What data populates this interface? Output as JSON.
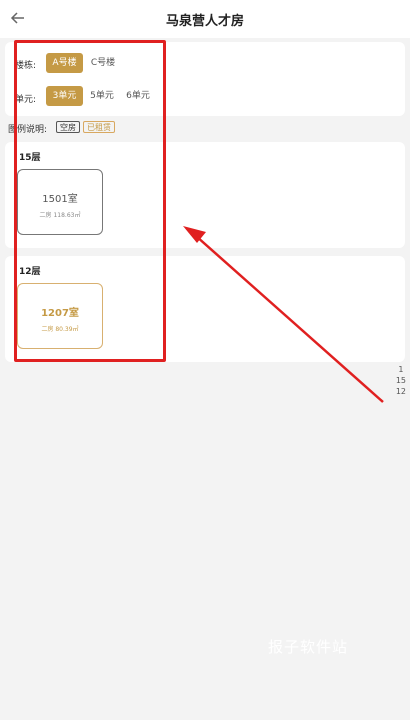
{
  "header": {
    "title": "马泉营人才房",
    "back_icon": "arrow-left-icon"
  },
  "filters": {
    "building_label": "楼栋:",
    "buildings": [
      {
        "label": "A号楼",
        "active": true
      },
      {
        "label": "C号楼",
        "active": false
      }
    ],
    "unit_label": "单元:",
    "units": [
      {
        "label": "3单元",
        "active": true
      },
      {
        "label": "5单元",
        "active": false
      },
      {
        "label": "6单元",
        "active": false
      }
    ]
  },
  "legend": {
    "label": "图例说明:",
    "empty": "空房",
    "rented": "已租赁"
  },
  "floors": [
    {
      "title": "15层",
      "room": {
        "name": "1501室",
        "info": "二房 118.63㎡",
        "status": "vacant"
      }
    },
    {
      "title": "12层",
      "room": {
        "name": "1207室",
        "info": "二房 80.39㎡",
        "status": "rented"
      }
    }
  ],
  "floor_index": [
    "1",
    "15",
    "12"
  ],
  "watermark": "报子软件站",
  "colors": {
    "accent": "#c59a45",
    "annotation": "#e02020"
  }
}
